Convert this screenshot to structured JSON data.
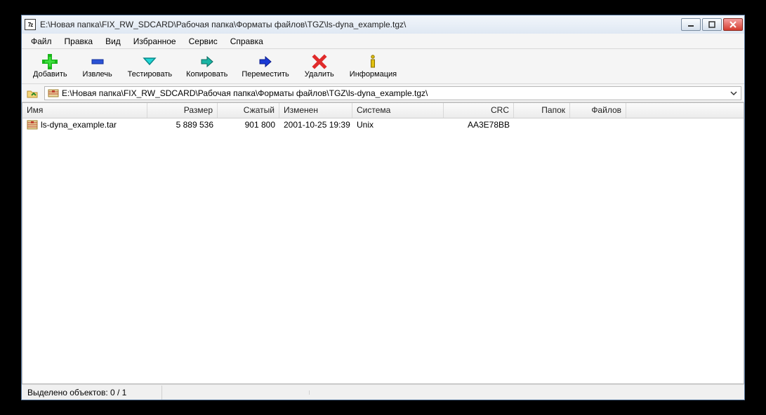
{
  "window": {
    "app_icon_text": "7z",
    "title": "E:\\Новая папка\\FIX_RW_SDCARD\\Рабочая папка\\Форматы файлов\\TGZ\\ls-dyna_example.tgz\\"
  },
  "menu": {
    "file": "Файл",
    "edit": "Правка",
    "view": "Вид",
    "favorites": "Избранное",
    "service": "Сервис",
    "help": "Справка"
  },
  "toolbar": {
    "add": "Добавить",
    "extract": "Извлечь",
    "test": "Тестировать",
    "copy": "Копировать",
    "move": "Переместить",
    "delete": "Удалить",
    "info": "Информация"
  },
  "path": {
    "value": "E:\\Новая папка\\FIX_RW_SDCARD\\Рабочая папка\\Форматы файлов\\TGZ\\ls-dyna_example.tgz\\"
  },
  "columns": {
    "name": "Имя",
    "size": "Размер",
    "packed": "Сжатый",
    "modified": "Изменен",
    "system": "Система",
    "crc": "CRC",
    "folders": "Папок",
    "files": "Файлов"
  },
  "rows": [
    {
      "name": "ls-dyna_example.tar",
      "size": "5 889 536",
      "packed": "901 800",
      "modified": "2001-10-25 19:39",
      "system": "Unix",
      "crc": "AA3E78BB",
      "folders": "",
      "files": ""
    }
  ],
  "status": {
    "selection": "Выделено объектов: 0 / 1"
  }
}
